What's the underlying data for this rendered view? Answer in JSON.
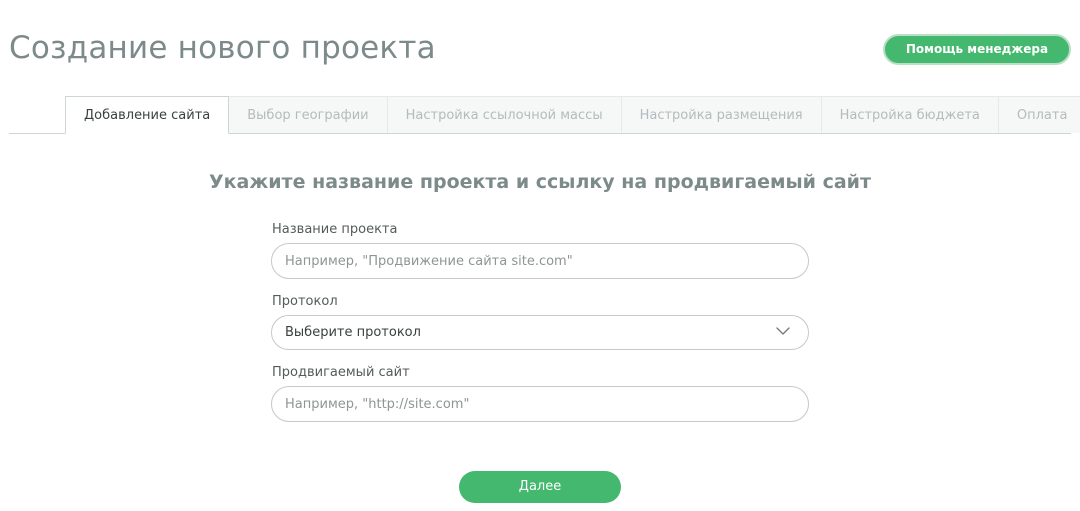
{
  "header": {
    "title": "Создание нового проекта",
    "manager_help_label": "Помощь менеджера"
  },
  "tabs": [
    {
      "label": "Добавление сайта",
      "active": true
    },
    {
      "label": "Выбор географии",
      "active": false
    },
    {
      "label": "Настройка ссылочной массы",
      "active": false
    },
    {
      "label": "Настройка размещения",
      "active": false
    },
    {
      "label": "Настройка бюджета",
      "active": false
    },
    {
      "label": "Оплата",
      "active": false
    }
  ],
  "form": {
    "heading": "Укажите название проекта и ссылку на продвигаемый сайт",
    "project_name": {
      "label": "Название проекта",
      "value": "",
      "placeholder": "Например, \"Продвижение сайта site.com\""
    },
    "protocol": {
      "label": "Протокол",
      "selected": "Выберите протокол",
      "icon": "chevron-down-icon"
    },
    "site": {
      "label": "Продвигаемый сайт",
      "value": "",
      "placeholder": "Например, \"http://site.com\""
    },
    "next_label": "Далее"
  },
  "colors": {
    "accent_green": "#45b86f",
    "title_gray": "#7d8a8a",
    "inactive_tab_text": "#b3bcbc"
  }
}
